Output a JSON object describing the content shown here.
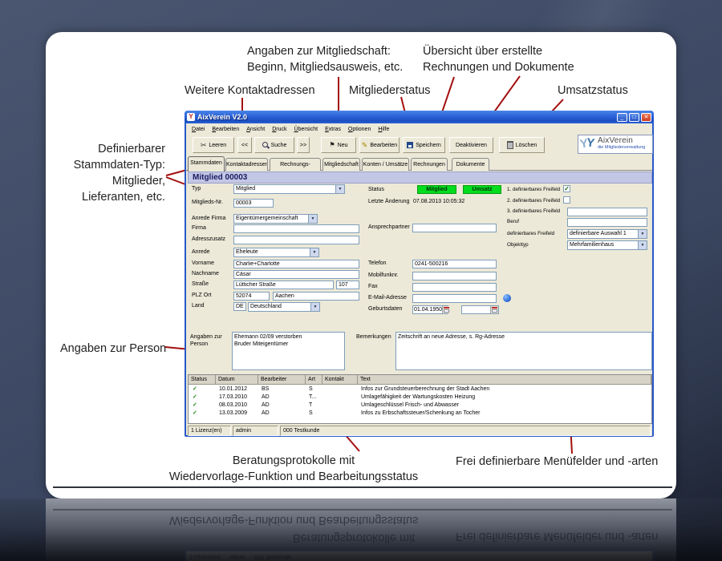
{
  "colors": {
    "annotation_line": "#a30f0f",
    "badge_green": "#00dc1e",
    "titlebar_blue": "#2a62d8",
    "page_background": "#3d4963",
    "window_chrome": "#ece9d8"
  },
  "annotations": {
    "stammdaten_typ": {
      "l1": "Definierbarer",
      "l2": "Stammdaten-Typ:",
      "l3": "Mitglieder,",
      "l4": "Lieferanten, etc."
    },
    "weitere_kontaktadressen": "Weitere Kontaktadressen",
    "mitgliedschaft": {
      "l1": "Angaben zur Mitgliedschaft:",
      "l2": "Beginn, Mitgliedsausweis, etc."
    },
    "mitgliederstatus": "Mitgliederstatus",
    "uebersicht": {
      "l1": "Übersicht über erstellte",
      "l2": "Rechnungen und Dokumente"
    },
    "umsatzstatus": "Umsatzstatus",
    "angaben_person": "Angaben zur Person",
    "beratung": {
      "l1": "Beratungsprotokolle mit",
      "l2": "Wiedervorlage-Funktion und Bearbeitungsstatus"
    },
    "frei": "Frei definierbare Menüfelder und -arten"
  },
  "window": {
    "title": "AixVerein V2.0",
    "controls": {
      "minimize": "_",
      "maximize": "□",
      "close": "✕"
    },
    "menu": [
      "Datei",
      "Bearbeiten",
      "Ansicht",
      "Druck",
      "Übersicht",
      "Extras",
      "Optionen",
      "Hilfe"
    ],
    "toolbar": {
      "leeren": "Leeren",
      "prev": "<<",
      "suche": "Suche",
      "next": ">>",
      "neu": "Neu",
      "bearbeiten": "Bearbeiten",
      "speichern": "Speichern",
      "deaktivieren": "Deaktivieren",
      "loeschen": "Löschen"
    },
    "logo": {
      "name": "AixVerein",
      "tagline": "die Mitgliederverwaltung"
    },
    "tabs": [
      "Stammdaten",
      "Kontaktadressen",
      "Rechnungs-Adresse",
      "Mitgliedschaft",
      "Konten / Umsätze",
      "Rechnungen",
      "Dokumente"
    ],
    "record_header": "Mitglied 00003",
    "form": {
      "typ": {
        "label": "Typ",
        "value": "Mitglied"
      },
      "mitglieds_nr": {
        "label": "Mitglieds-Nr.",
        "value": "00003"
      },
      "anrede_firma": {
        "label": "Anrede Firma",
        "value": "Eigentümergemeinschaft"
      },
      "firma": {
        "label": "Firma",
        "value": ""
      },
      "adresszusatz": {
        "label": "Adresszusatz",
        "value": ""
      },
      "anrede": {
        "label": "Anrede",
        "value": "Eheleute"
      },
      "vorname": {
        "label": "Vorname",
        "value": "Charlie+Charlotte"
      },
      "nachname": {
        "label": "Nachname",
        "value": "Cäsar"
      },
      "strasse": {
        "label": "Straße",
        "value": "Lütticher Straße",
        "nr": "107"
      },
      "plz_ort": {
        "label": "PLZ Ort",
        "plz": "52074",
        "ort": "Aachen"
      },
      "land": {
        "label": "Land",
        "code": "DE",
        "value": "Deutschland"
      },
      "status": {
        "label": "Status",
        "badge1": "Mitglied",
        "badge2": "Umsatz"
      },
      "letzte_aenderung": {
        "label": "Letzte Änderung",
        "value": "07.08.2013 10:05:32"
      },
      "ansprechpartner": {
        "label": "Ansprechpartner",
        "value": ""
      },
      "telefon": {
        "label": "Telefon",
        "value": "0241-500216"
      },
      "mobilfunk": {
        "label": "Mobilfunknr.",
        "value": ""
      },
      "fax": {
        "label": "Fax",
        "value": ""
      },
      "email": {
        "label": "E-Mail-Adresse",
        "value": ""
      },
      "geburtsdaten": {
        "label": "Geburtsdaten",
        "value": "01.04.1950",
        "value2": ""
      },
      "freifeld1": {
        "label": "1. definierbares Freifeld",
        "check": "✓"
      },
      "freifeld2": {
        "label": "2. definierbares Freifeld",
        "check": ""
      },
      "freifeld3": {
        "label": "3. definierbares Freifeld",
        "value": ""
      },
      "beruf": {
        "label": "Beruf",
        "value": ""
      },
      "freifeld_auswahl": {
        "label": "definierbares Freifeld",
        "value": "definierbare Auswahl 1"
      },
      "objekttyp": {
        "label": "Objekttyp",
        "value": "Mehrfamilienhaus"
      },
      "angaben_person": {
        "label1": "Angaben zur",
        "label2": "Person",
        "value": "Ehemann 02/09 verstorben\nBruder Miteigentümer"
      },
      "bemerkungen": {
        "label": "Bemerkungen",
        "value": "Zeitschrift an neue Adresse, s. Rg-Adresse"
      }
    },
    "table": {
      "columns": [
        "Status",
        "Datum",
        "Bearbeiter",
        "Art",
        "Kontakt",
        "Text"
      ],
      "rows": [
        {
          "status": "✓",
          "datum": "10.01.2012",
          "bearbeiter": "BS",
          "art": "S",
          "kontakt": "",
          "text": "Infos zur Grundsteuerberechnung der Stadt Aachen"
        },
        {
          "status": "✓",
          "datum": "17.03.2010",
          "bearbeiter": "AD",
          "art": "T...",
          "kontakt": "",
          "text": "Umlagefähigkeit der Wartungskosten Heizung"
        },
        {
          "status": "✓",
          "datum": "08.03.2010",
          "bearbeiter": "AD",
          "art": "T",
          "kontakt": "",
          "text": "Umlageschlüssel Frisch- und Abwasser"
        },
        {
          "status": "✓",
          "datum": "13.03.2009",
          "bearbeiter": "AD",
          "art": "S",
          "kontakt": "",
          "text": "Infos zu Erbschaftssteuer/Schenkung an Tocher"
        }
      ]
    },
    "statusbar": {
      "licenses": "1 Lizenz(en)",
      "user": "admin",
      "customer": "000 Testkunde"
    }
  }
}
